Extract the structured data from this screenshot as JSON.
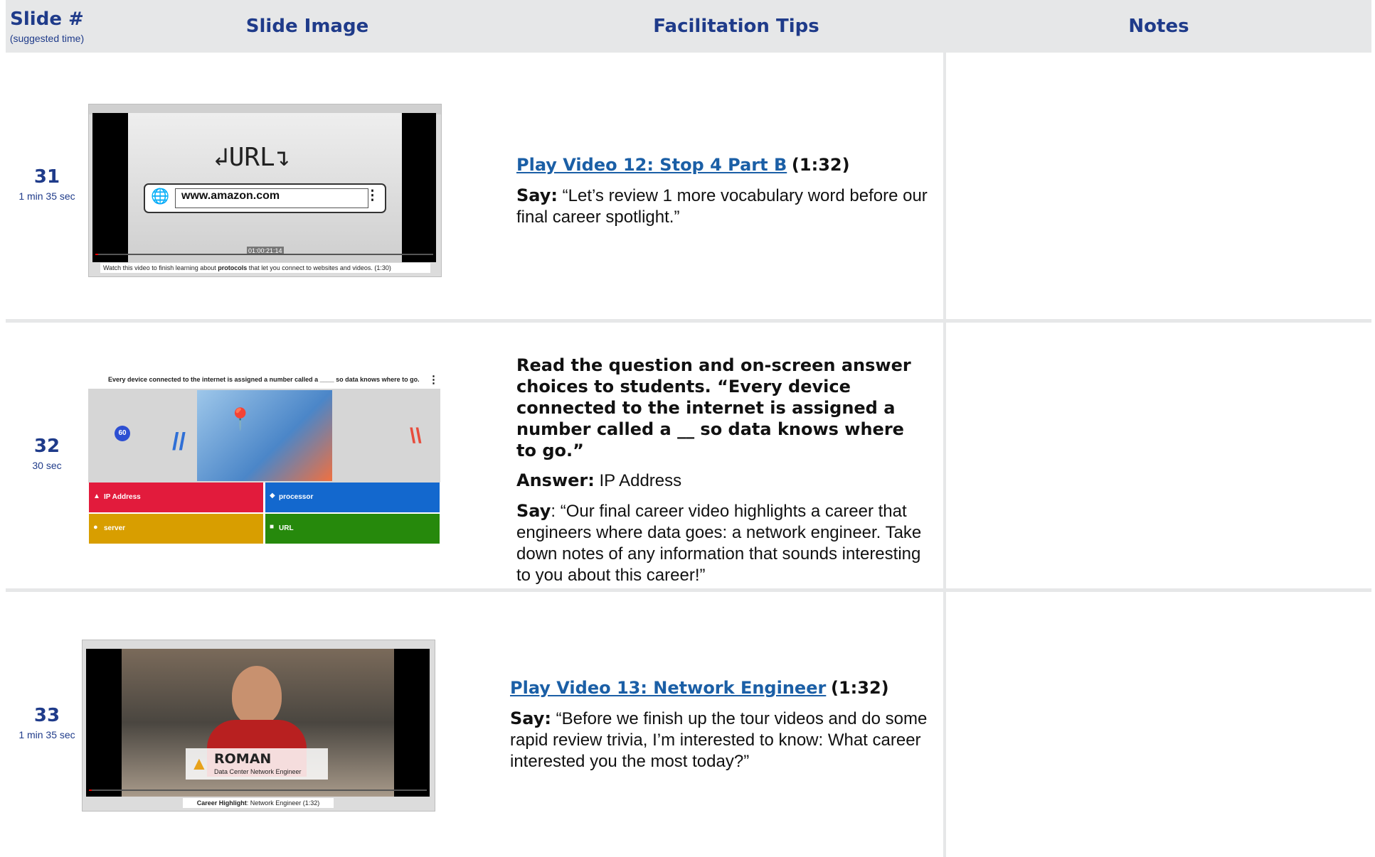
{
  "header": {
    "slide_num": "Slide #",
    "slide_num_sub": "(suggested time)",
    "slide_image": "Slide Image",
    "facilitation_tips": "Facilitation Tips",
    "notes": "Notes"
  },
  "rows": [
    {
      "number": "31",
      "time": "1 min 35 sec",
      "thumb": {
        "heading": "URL",
        "address": "www.amazon.com",
        "timecode": "01:00:21:14",
        "caption_pre": "Watch this video to finish learning about ",
        "caption_bold": "protocols",
        "caption_post": " that let you connect to websites and videos. (1:30)"
      },
      "link": "Play Video 12: Stop 4 Part B",
      "duration": "(1:32)",
      "say_label": "Say:",
      "say_text": " “Let’s review 1 more vocabulary word before our final career spotlight.”"
    },
    {
      "number": "32",
      "time": "30 sec",
      "thumb": {
        "question": "Every device connected to the internet is assigned a number called a ____ so data knows where to go.",
        "timer": "60",
        "answers": [
          "IP Address",
          "processor",
          "server",
          "URL"
        ]
      },
      "bold_text": "Read the question and on-screen answer choices to students. “Every device connected to the internet is assigned a number called a __ so data knows where to go.”",
      "answer_label": "Answer:",
      "answer_text": " IP Address",
      "say_label": "Say",
      "say_text": ": “Our final career video highlights a career that engineers where data goes: a network engineer. Take down notes of any information that sounds interesting to you about this career!”"
    },
    {
      "number": "33",
      "time": "1 min 35 sec",
      "thumb": {
        "name": "ROMAN",
        "role": "Data Center Network Engineer",
        "caption_bold": "Career Highlight",
        "caption_post": ": Network Engineer (1:32)"
      },
      "link": "Play Video 13: Network Engineer",
      "duration": "(1:32)",
      "say_label": "Say:",
      "say_text": " “Before we finish up the tour videos and do some rapid review trivia, I’m interested to know: What career interested you the most today?”"
    }
  ],
  "colors": {
    "header_bg": "#e6e7e8",
    "navy": "#1f3b8a",
    "link": "#1b5fa6",
    "answer_red": "#e21b3c",
    "answer_blue": "#1368ce",
    "answer_yellow": "#d89e00",
    "answer_green": "#26890c"
  }
}
